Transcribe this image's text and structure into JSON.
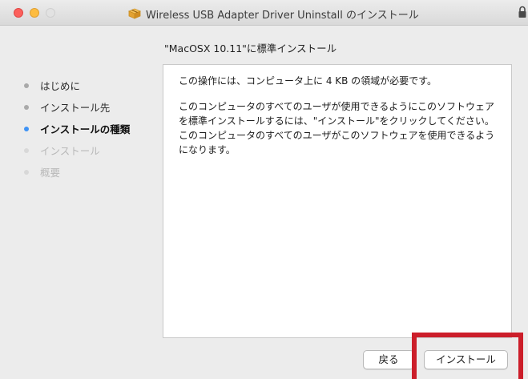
{
  "window": {
    "title": "Wireless USB Adapter Driver Uninstall のインストール"
  },
  "page": {
    "subtitle": "\"MacOSX 10.11\"に標準インストール"
  },
  "sidebar": {
    "steps": [
      {
        "label": "はじめに",
        "state": "done"
      },
      {
        "label": "インストール先",
        "state": "done"
      },
      {
        "label": "インストールの種類",
        "state": "current"
      },
      {
        "label": "インストール",
        "state": "future"
      },
      {
        "label": "概要",
        "state": "future"
      }
    ]
  },
  "content": {
    "line1": "この操作には、コンピュータ上に 4 KB の領域が必要です。",
    "line2": "このコンピュータのすべてのユーザが使用できるようにこのソフトウェアを標準インストールするには、\"インストール\"をクリックしてください。このコンピュータのすべてのユーザがこのソフトウェアを使用できるようになります。"
  },
  "buttons": {
    "back": "戻る",
    "install": "インストール"
  },
  "colors": {
    "current_step_dot": "#3f93f5",
    "highlight": "#cc1e2a"
  }
}
